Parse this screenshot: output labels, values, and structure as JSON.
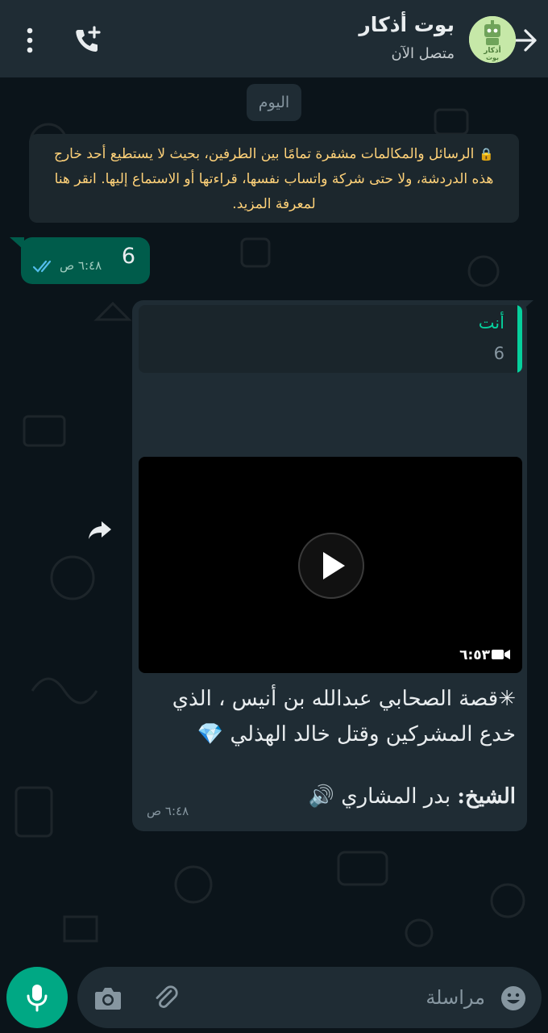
{
  "header": {
    "contact_name": "بوت أذكار",
    "contact_status": "متصل الآن",
    "avatar_text": "أذكار\nبوت"
  },
  "chat": {
    "date_chip": "اليوم",
    "encryption_notice": "الرسائل والمكالمات مشفرة تمامًا بين الطرفين، بحيث لا يستطيع أحد خارج هذه الدردشة، ولا حتى شركة واتساب نفسها، قراءتها أو الاستماع إليها. انقر هنا لمعرفة المزيد.",
    "outgoing": {
      "text": "6",
      "time": "٦:٤٨ ص",
      "status": "read"
    },
    "incoming": {
      "quote_author": "أنت",
      "quote_text": "6",
      "video_duration": "٦:٥٣",
      "caption_line1": "✳قصة الصحابي عبدالله بن أنيس ، الذي",
      "caption_line2": "خدع المشركين وقتل خالد الهذلي 💎",
      "sheikh_label": "الشيخ:",
      "sheikh_name": " بدر المشاري 🔊",
      "time": "٦:٤٨ ص"
    }
  },
  "composer": {
    "placeholder": "مراسلة"
  },
  "colors": {
    "header_bg": "#1f2c34",
    "chat_bg": "#0b141a",
    "outgoing_bubble": "#005c4b",
    "incoming_bubble": "#1f2c34",
    "accent": "#00a884",
    "notice_text": "#ffd279",
    "read_ticks": "#53bdeb"
  }
}
